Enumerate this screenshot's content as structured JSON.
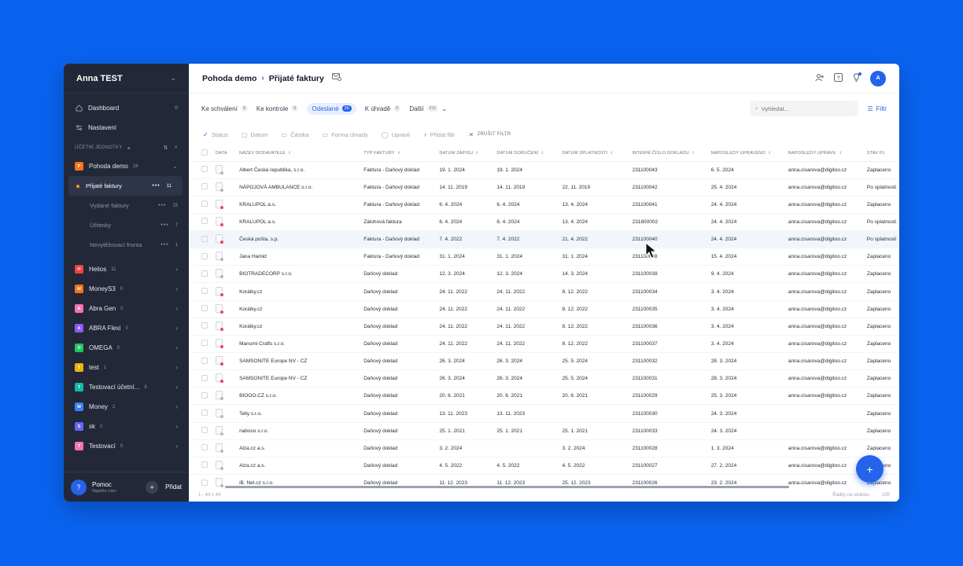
{
  "sidebar": {
    "user_name": "Anna TEST",
    "menu": [
      {
        "label": "Dashboard",
        "count": "0",
        "icon": "home-icon"
      },
      {
        "label": "Nastavení",
        "count": "",
        "icon": "settings-sliders-icon"
      }
    ],
    "section_label": "ÚČETNÍ JEDNOTKY",
    "current_org": {
      "badge": "P",
      "name": "Pohoda demo",
      "count": "24",
      "color": "#f97316"
    },
    "sub_items": [
      {
        "label": "Přijaté faktury",
        "count": "11",
        "active": true
      },
      {
        "label": "Vydané faktury",
        "count": "15",
        "active": false
      },
      {
        "label": "Účtenky",
        "count": "7",
        "active": false
      },
      {
        "label": "Nevytěžovací fronta",
        "count": "1",
        "active": false
      }
    ],
    "orgs": [
      {
        "badge": "H",
        "name": "Helios",
        "count": "11",
        "color": "#ef4444"
      },
      {
        "badge": "M",
        "name": "MoneyS3",
        "count": "0",
        "color": "#f97316"
      },
      {
        "badge": "A",
        "name": "Abra Gen",
        "count": "0",
        "color": "#f472b6"
      },
      {
        "badge": "A",
        "name": "ABRA Flexi",
        "count": "0",
        "color": "#8b5cf6"
      },
      {
        "badge": "O",
        "name": "OMEGA",
        "count": "0",
        "color": "#22c55e"
      },
      {
        "badge": "T",
        "name": "test",
        "count": "1",
        "color": "#eab308"
      },
      {
        "badge": "T",
        "name": "Testovací účetní...",
        "count": "6",
        "color": "#14b8a6"
      },
      {
        "badge": "M",
        "name": "Money",
        "count": "2",
        "color": "#3b82f6"
      },
      {
        "badge": "S",
        "name": "sk",
        "count": "0",
        "color": "#6366f1"
      },
      {
        "badge": "T",
        "name": "Testovací",
        "count": "0",
        "color": "#f472b6"
      }
    ],
    "help_title": "Pomoc",
    "help_sub": "Napište nám",
    "add_label": "Přidat"
  },
  "header": {
    "crumb_root": "Pohoda demo",
    "crumb_page": "Přijaté faktury",
    "avatar": "A"
  },
  "tabs": [
    {
      "label": "Ke schválení",
      "count": "9",
      "active": false
    },
    {
      "label": "Ke kontrole",
      "count": "6",
      "active": false
    },
    {
      "label": "Odeslané",
      "count": "26",
      "active": true
    },
    {
      "label": "K úhradě",
      "count": "0",
      "active": false
    },
    {
      "label": "Další",
      "count": "211",
      "active": false
    }
  ],
  "search": {
    "placeholder": "Vyhledat..."
  },
  "filter_label": "Filtr",
  "filters": [
    "Status",
    "Datum",
    "Částka",
    "Forma úhrady",
    "Upravil",
    "Přidat filtr",
    "ZRUŠIT FILTR"
  ],
  "columns": [
    "DATA",
    "NÁZEV DODAVATELE",
    "TYP FAKTURY",
    "DATUM ZÁPISU",
    "DATUM DORUČENÍ",
    "DATUM SPLATNOSTI",
    "INTERNÍ ČÍSLO DOKLADU",
    "NAPOSLEDY UPRAVENO",
    "NAPOSLEDY UPRAVIL",
    "STAV PL"
  ],
  "rows": [
    [
      "Albert Česká republika, s.r.o.",
      "Faktura - Daňový doklad",
      "19. 1. 2024",
      "19. 1. 2024",
      "",
      "231100043",
      "6. 5. 2024",
      "anna.cisarova@digitoo.cz",
      "Zaplaceno"
    ],
    [
      "NÁPOJOVÁ AMBULANCE s.r.o.",
      "Faktura - Daňový doklad",
      "14. 11. 2019",
      "14. 11. 2019",
      "22. 11. 2019",
      "231100042",
      "25. 4. 2024",
      "anna.cisarova@digitoo.cz",
      "Po splatnosti"
    ],
    [
      "KRALUPOL a.s.",
      "Faktura - Daňový doklad",
      "6. 4. 2024",
      "6. 4. 2024",
      "13. 4. 2024",
      "231100041",
      "24. 4. 2024",
      "anna.cisarova@digitoo.cz",
      "Zaplaceno"
    ],
    [
      "KRALUPOL a.s.",
      "Zálohová faktura",
      "6. 4. 2024",
      "6. 4. 2024",
      "13. 4. 2024",
      "231800002",
      "24. 4. 2024",
      "anna.cisarova@digitoo.cz",
      "Po splatnosti"
    ],
    [
      "Česká pošta, s.p.",
      "Faktura - Daňový doklad",
      "7. 4. 2022",
      "7. 4. 2022",
      "21. 4. 2022",
      "231100040",
      "24. 4. 2024",
      "anna.cisarova@digitoo.cz",
      "Po splatnosti"
    ],
    [
      "Jana Hamid",
      "Faktura - Daňový doklad",
      "31. 1. 2024",
      "31. 1. 2024",
      "31. 1. 2024",
      "231100038",
      "15. 4. 2024",
      "anna.cisarova@digitoo.cz",
      "Zaplaceno"
    ],
    [
      "BIOTRADECORP s.r.o.",
      "Daňový doklad",
      "12. 3. 2024",
      "12. 3. 2024",
      "14. 3. 2024",
      "231100039",
      "9. 4. 2024",
      "anna.cisarova@digitoo.cz",
      "Zaplaceno"
    ],
    [
      "Korálky.cz",
      "Daňový doklad",
      "24. 11. 2022",
      "24. 11. 2022",
      "8. 12. 2022",
      "231100034",
      "3. 4. 2024",
      "anna.cisarova@digitoo.cz",
      "Zaplaceno"
    ],
    [
      "Korálky.cz",
      "Daňový doklad",
      "24. 11. 2022",
      "24. 11. 2022",
      "8. 12. 2022",
      "231100035",
      "3. 4. 2024",
      "anna.cisarova@digitoo.cz",
      "Zaplaceno"
    ],
    [
      "Korálky.cz",
      "Daňový doklad",
      "24. 11. 2022",
      "24. 11. 2022",
      "8. 12. 2022",
      "231100036",
      "3. 4. 2024",
      "anna.cisarova@digitoo.cz",
      "Zaplaceno"
    ],
    [
      "Manumi Crafts s.r.o.",
      "Daňový doklad",
      "24. 11. 2022",
      "24. 11. 2022",
      "8. 12. 2022",
      "231100037",
      "3. 4. 2024",
      "anna.cisarova@digitoo.cz",
      "Zaplaceno"
    ],
    [
      "SAMSONITE Europe NV - CZ",
      "Daňový doklad",
      "26. 3. 2024",
      "26. 3. 2024",
      "25. 5. 2024",
      "231100032",
      "28. 3. 2024",
      "anna.cisarova@digitoo.cz",
      "Zaplaceno"
    ],
    [
      "SAMSONITE Europe NV - CZ",
      "Daňový doklad",
      "26. 3. 2024",
      "26. 3. 2024",
      "25. 5. 2024",
      "231100031",
      "28. 3. 2024",
      "anna.cisarova@digitoo.cz",
      "Zaplaceno"
    ],
    [
      "BIOOO.CZ s.r.o.",
      "Daňový doklad",
      "20. 6. 2021",
      "20. 6. 2021",
      "20. 6. 2021",
      "231100029",
      "25. 3. 2024",
      "anna.cisarova@digitoo.cz",
      "Zaplaceno"
    ],
    [
      "Telly s.r.o.",
      "Daňový doklad",
      "13. 11. 2023",
      "13. 11. 2023",
      "",
      "231100030",
      "24. 3. 2024",
      "",
      "Zaplaceno"
    ],
    [
      "naboso s.r.o.",
      "Daňový doklad",
      "25. 1. 2021",
      "25. 1. 2021",
      "25. 1. 2021",
      "231100033",
      "24. 3. 2024",
      "",
      "Zaplaceno"
    ],
    [
      "Alza.cz a.s.",
      "Daňový doklad",
      "3. 2. 2024",
      "",
      "3. 2. 2024",
      "231100028",
      "1. 3. 2024",
      "anna.cisarova@digitoo.cz",
      "Zaplaceno"
    ],
    [
      "Alza.cz a.s.",
      "Daňový doklad",
      "4. 5. 2022",
      "4. 5. 2022",
      "4. 5. 2022",
      "231100027",
      "27. 2. 2024",
      "anna.cisarova@digitoo.cz",
      "Zaplaceno"
    ],
    [
      "iB. Net.cz s.r.o.",
      "Daňový doklad",
      "11. 12. 2023",
      "11. 12. 2023",
      "25. 12. 2023",
      "231100026",
      "23. 2. 2024",
      "anna.cisarova@digitoo.cz",
      "Zaplaceno"
    ]
  ],
  "footer": {
    "range": "1 - 44 z 44",
    "rows_per_page": "Řádky na stránku",
    "page_size": "100"
  },
  "colors": {
    "accent": "#2563eb",
    "sidebar_bg": "#232838",
    "background": "#0a63f0"
  }
}
